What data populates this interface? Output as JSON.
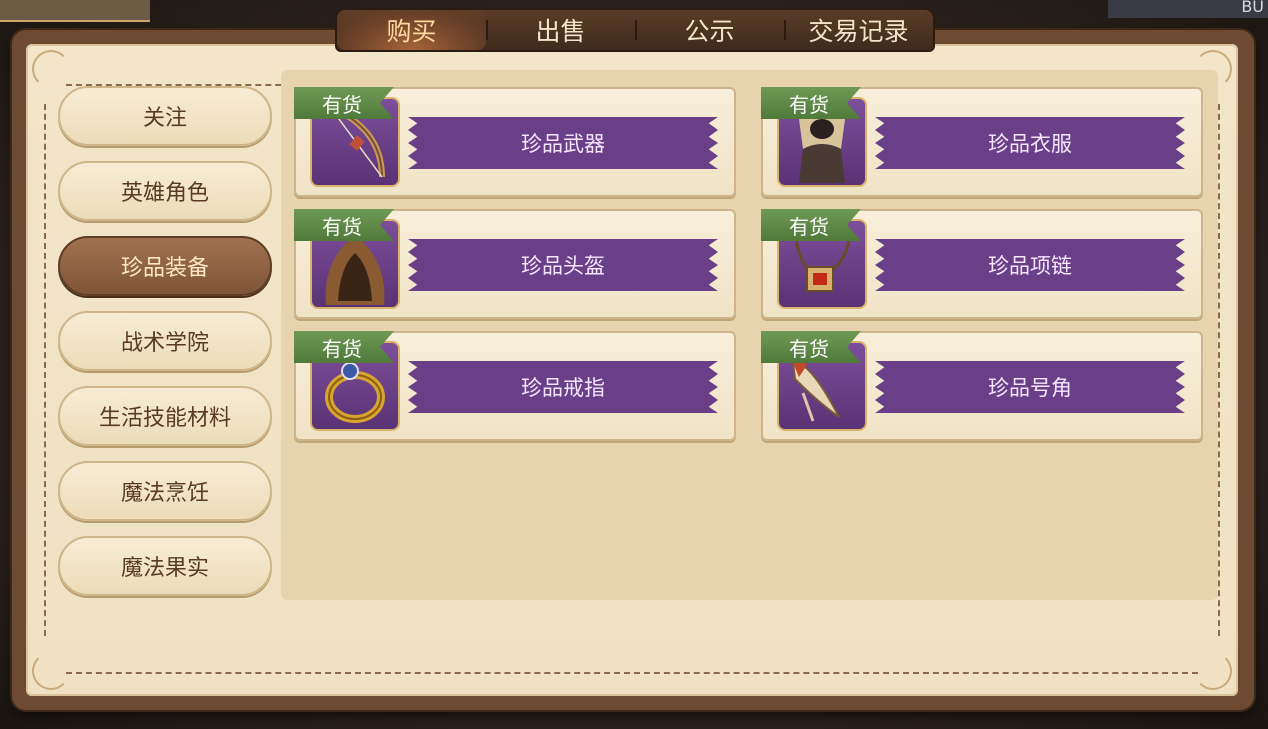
{
  "top_right_text": "BU",
  "tabs": [
    {
      "label": "购买",
      "active": true
    },
    {
      "label": "出售",
      "active": false
    },
    {
      "label": "公示",
      "active": false
    },
    {
      "label": "交易记录",
      "active": false
    }
  ],
  "nav": [
    {
      "label": "关注",
      "active": false
    },
    {
      "label": "英雄角色",
      "active": false
    },
    {
      "label": "珍品装备",
      "active": true
    },
    {
      "label": "战术学院",
      "active": false
    },
    {
      "label": "生活技能材料",
      "active": false
    },
    {
      "label": "魔法烹饪",
      "active": false
    },
    {
      "label": "魔法果实",
      "active": false
    }
  ],
  "items": [
    {
      "name": "珍品武器",
      "stock": "有货",
      "icon": "bow-icon"
    },
    {
      "name": "珍品衣服",
      "stock": "有货",
      "icon": "hooded-robe-icon"
    },
    {
      "name": "珍品头盔",
      "stock": "有货",
      "icon": "hood-icon"
    },
    {
      "name": "珍品项链",
      "stock": "有货",
      "icon": "necklace-icon"
    },
    {
      "name": "珍品戒指",
      "stock": "有货",
      "icon": "ring-icon"
    },
    {
      "name": "珍品号角",
      "stock": "有货",
      "icon": "horn-icon"
    }
  ],
  "colors": {
    "frame": "#6e4a33",
    "paper": "#f3e6c8",
    "banner": "#6a3f88",
    "stock_tag": "#5f8a48",
    "nav_active": "#8a5e40"
  }
}
